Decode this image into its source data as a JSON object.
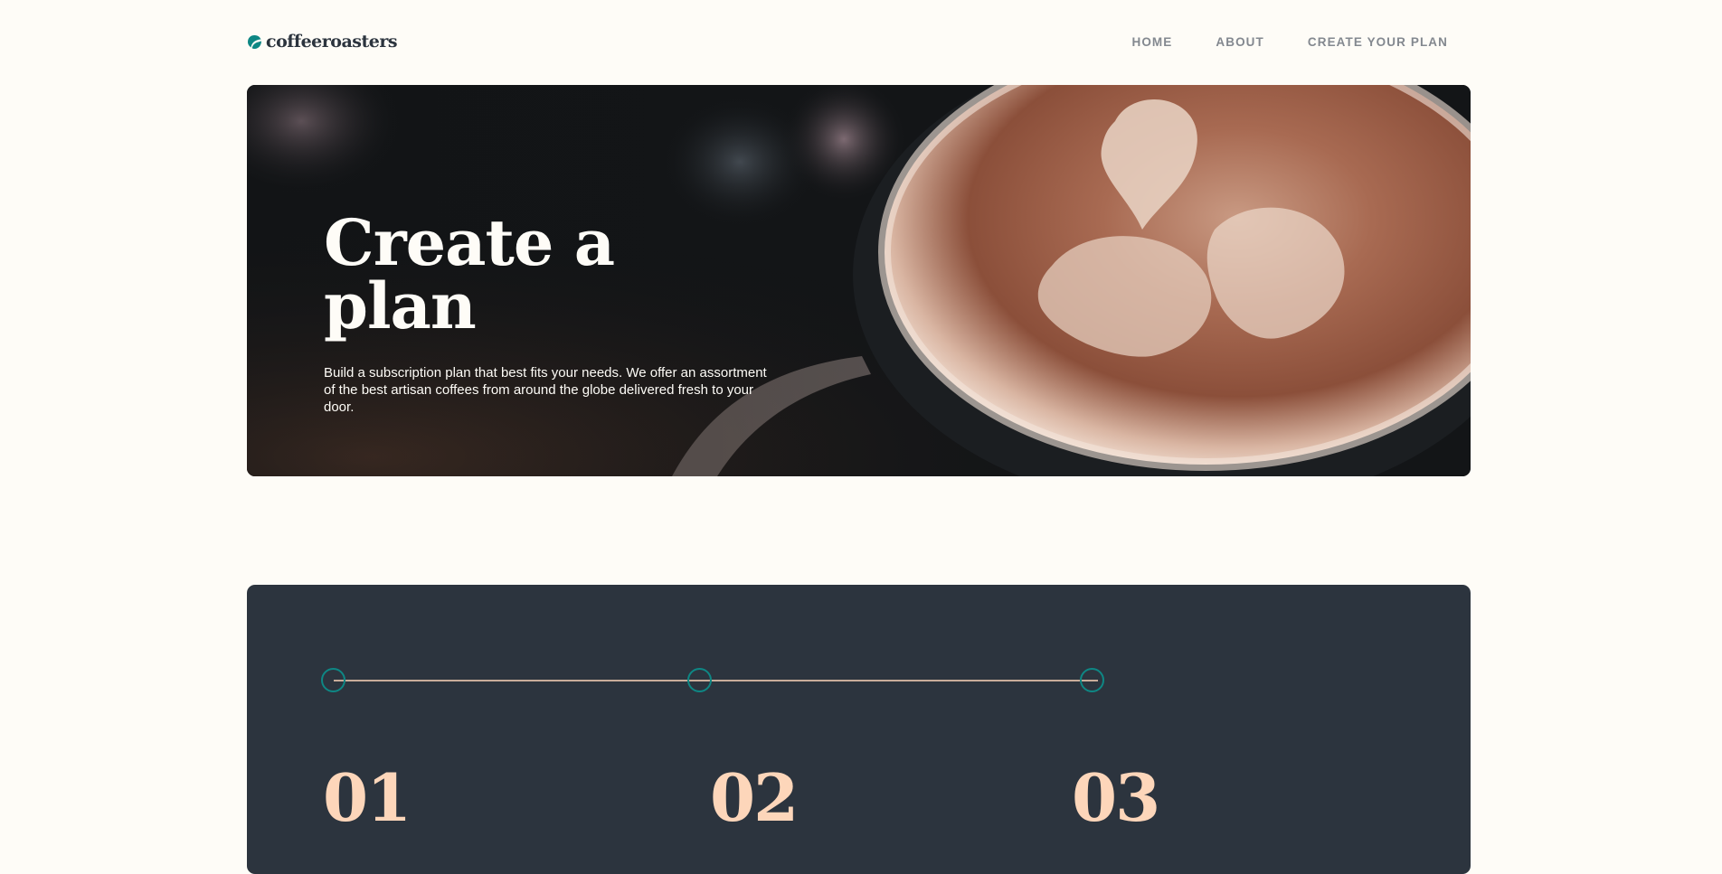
{
  "brand": {
    "name": "coffeeroasters",
    "accent": "#0E8784",
    "dark": "#2C343E",
    "cream": "#FEFCF7",
    "peach": "#FDD6BA"
  },
  "nav": {
    "items": [
      {
        "label": "HOME"
      },
      {
        "label": "ABOUT"
      },
      {
        "label": "CREATE YOUR PLAN"
      }
    ]
  },
  "hero": {
    "title": "Create a plan",
    "description": "Build a subscription plan that best fits your needs. We offer an assortment of the best artisan coffees from around the globe delivered fresh to your door."
  },
  "steps": {
    "numbers": [
      "01",
      "02",
      "03"
    ]
  }
}
